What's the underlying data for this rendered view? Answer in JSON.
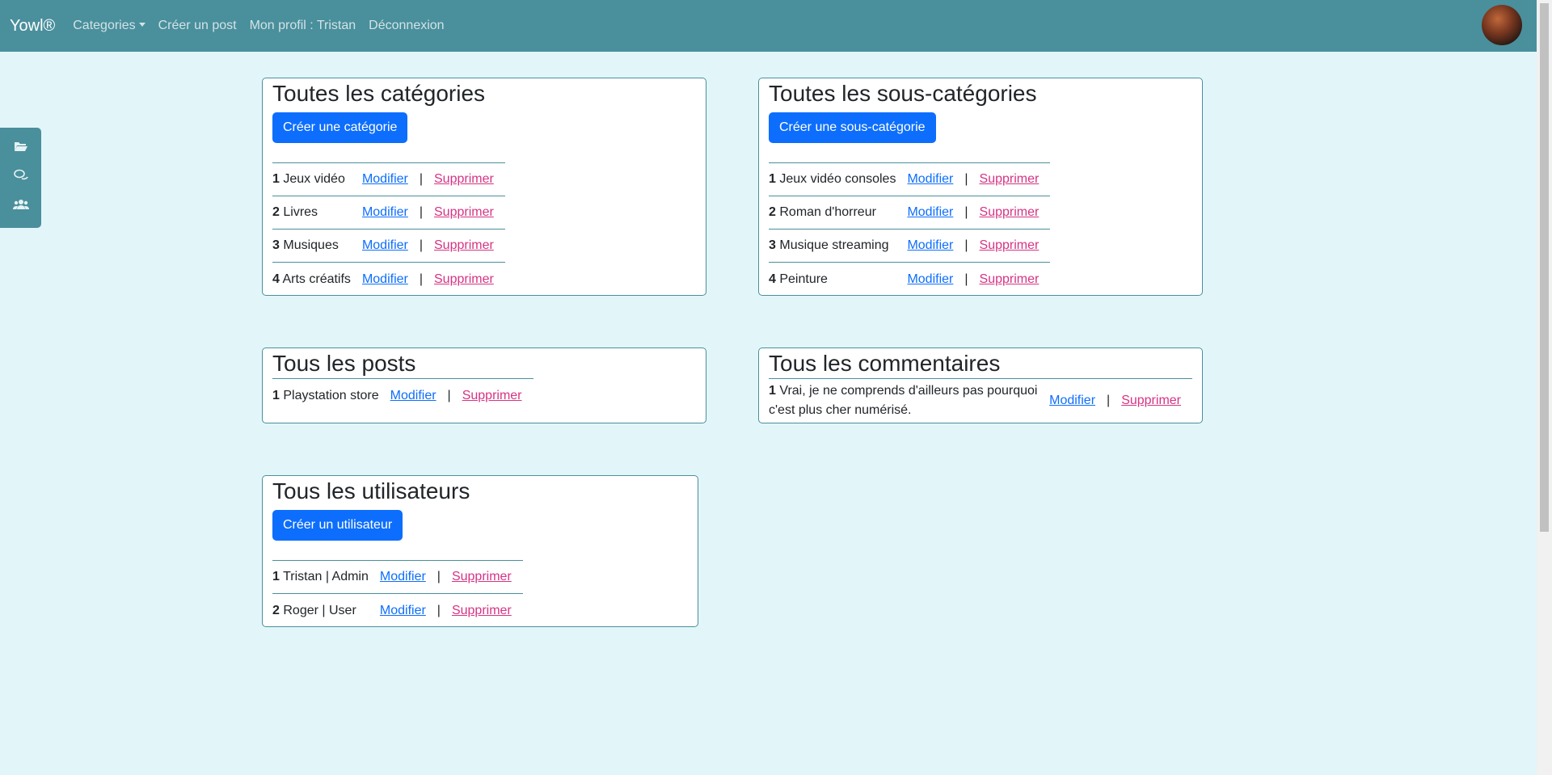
{
  "navbar": {
    "brand": "Yowl®",
    "links": {
      "categories": "Categories",
      "create_post": "Créer un post",
      "profile": "Mon profil : Tristan",
      "logout": "Déconnexion"
    }
  },
  "sidebar": {
    "icons": [
      "folder-open-icon",
      "comments-icon",
      "users-icon"
    ]
  },
  "actions": {
    "edit": "Modifier",
    "sep": "|",
    "delete": "Supprimer"
  },
  "categories": {
    "title": "Toutes les catégories",
    "create_button": "Créer une catégorie",
    "items": [
      {
        "num": "1",
        "name": "Jeux vidéo"
      },
      {
        "num": "2",
        "name": "Livres"
      },
      {
        "num": "3",
        "name": "Musiques"
      },
      {
        "num": "4",
        "name": "Arts créatifs"
      }
    ]
  },
  "subcategories": {
    "title": "Toutes les sous-catégories",
    "create_button": "Créer une sous-catégorie",
    "items": [
      {
        "num": "1",
        "name": "Jeux vidéo consoles"
      },
      {
        "num": "2",
        "name": "Roman d'horreur"
      },
      {
        "num": "3",
        "name": "Musique streaming"
      },
      {
        "num": "4",
        "name": "Peinture"
      }
    ]
  },
  "posts": {
    "title": "Tous les posts",
    "items": [
      {
        "num": "1",
        "name": "Playstation store"
      }
    ]
  },
  "comments": {
    "title": "Tous les commentaires",
    "items": [
      {
        "num": "1",
        "text": "Vrai, je ne comprends d'ailleurs pas pourquoi c'est plus cher numérisé."
      }
    ]
  },
  "users": {
    "title": "Tous les utilisateurs",
    "create_button": "Créer un utilisateur",
    "items": [
      {
        "num": "1",
        "name": "Tristan | Admin"
      },
      {
        "num": "2",
        "name": "Roger | User"
      }
    ]
  },
  "colors": {
    "accent": "#4a8f9c",
    "primary": "#0d6efd",
    "danger_link": "#d63384",
    "background": "#e2f6fa"
  }
}
